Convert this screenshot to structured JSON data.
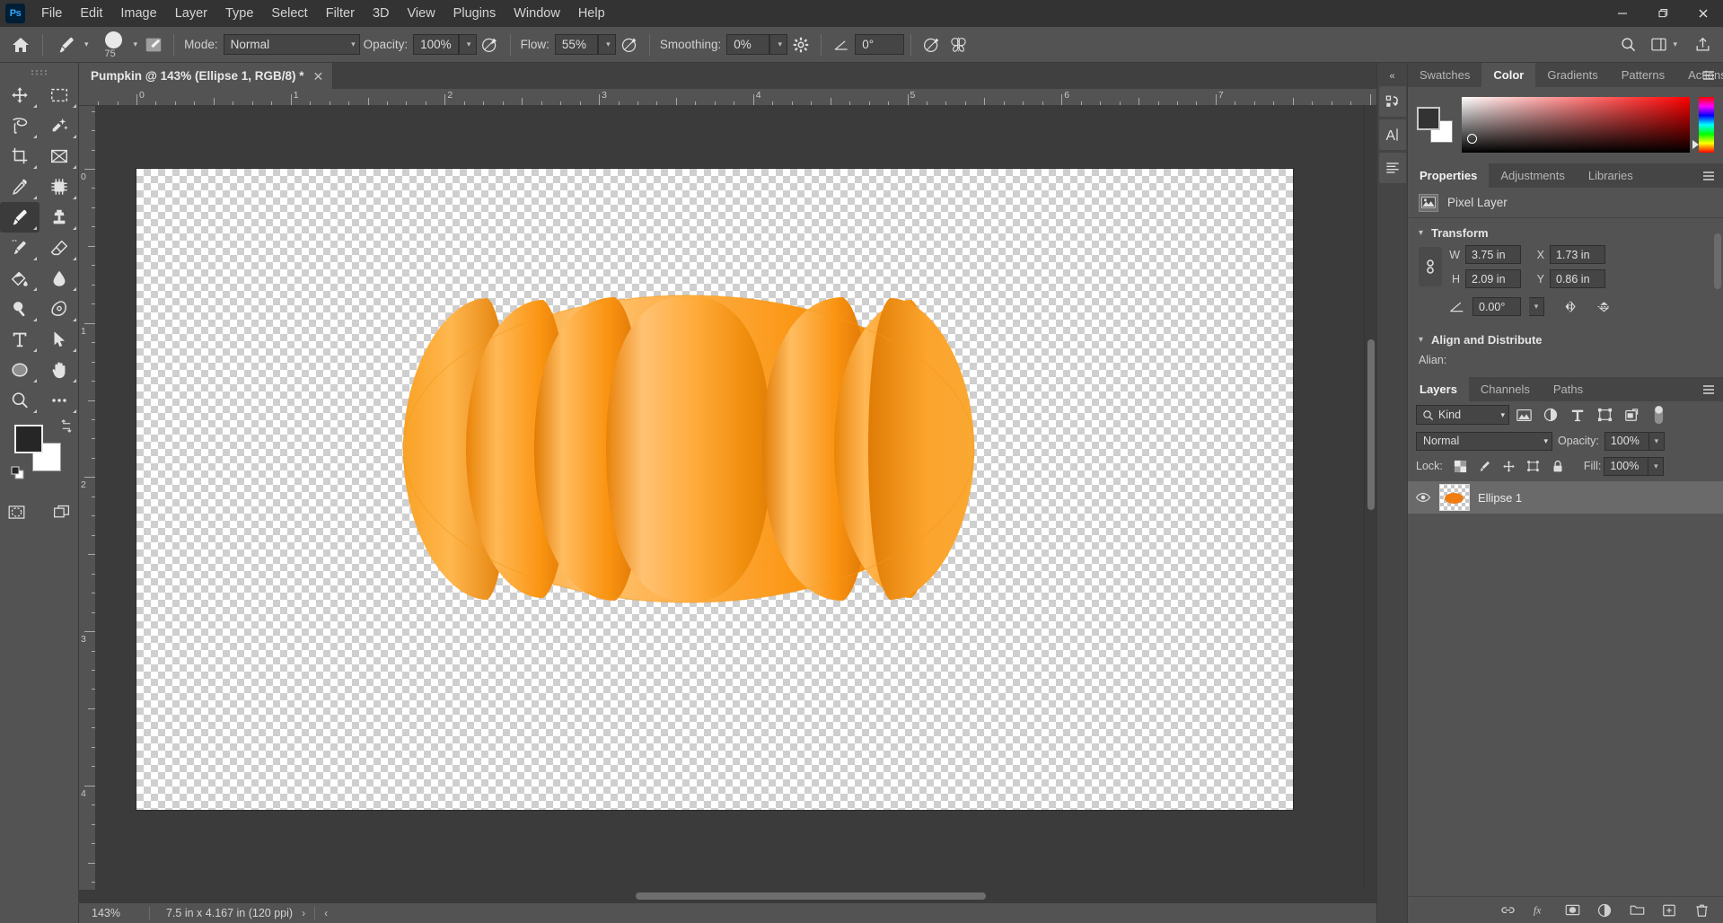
{
  "app": {
    "name": "Adobe Photoshop",
    "logo_text": "Ps",
    "accent": "#31a8ff"
  },
  "menubar": {
    "items": [
      {
        "label": "File"
      },
      {
        "label": "Edit"
      },
      {
        "label": "Image"
      },
      {
        "label": "Layer"
      },
      {
        "label": "Type"
      },
      {
        "label": "Select"
      },
      {
        "label": "Filter"
      },
      {
        "label": "3D"
      },
      {
        "label": "View"
      },
      {
        "label": "Plugins"
      },
      {
        "label": "Window"
      },
      {
        "label": "Help"
      }
    ],
    "window_controls": {
      "minimize": "—",
      "maximize": "❐",
      "close": "✕"
    }
  },
  "options_bar": {
    "home_icon": "home-icon",
    "brush_size": "75",
    "mode_label": "Mode:",
    "mode_value": "Normal",
    "opacity_label": "Opacity:",
    "opacity_value": "100%",
    "flow_label": "Flow:",
    "flow_value": "55%",
    "smoothing_label": "Smoothing:",
    "smoothing_value": "0%",
    "angle_value": "0°",
    "icons": {
      "airbrush": "airbrush-icon",
      "pressure_opacity": "pressure-opacity-icon",
      "pressure_size": "pressure-size-icon",
      "smoothing_options": "smoothing-options-gear-icon",
      "angle": "brush-angle-icon",
      "symmetry": "symmetry-butterfly-icon",
      "search": "search-icon",
      "workspace": "workspace-icon",
      "share": "share-icon"
    }
  },
  "toolbar": {
    "tools": [
      {
        "name": "move-tool",
        "selected": false
      },
      {
        "name": "rectangular-marquee-tool",
        "selected": false
      },
      {
        "name": "lasso-tool",
        "selected": false
      },
      {
        "name": "object-selection-tool",
        "selected": false
      },
      {
        "name": "crop-tool",
        "selected": false
      },
      {
        "name": "frame-tool",
        "selected": false
      },
      {
        "name": "eyedropper-tool",
        "selected": false
      },
      {
        "name": "spot-healing-brush-tool",
        "selected": false
      },
      {
        "name": "brush-tool",
        "selected": true
      },
      {
        "name": "clone-stamp-tool",
        "selected": false
      },
      {
        "name": "history-brush-tool",
        "selected": false
      },
      {
        "name": "eraser-tool",
        "selected": false
      },
      {
        "name": "gradient-tool",
        "selected": false
      },
      {
        "name": "blur-tool",
        "selected": false
      },
      {
        "name": "dodge-tool",
        "selected": false
      },
      {
        "name": "pen-tool",
        "selected": false
      },
      {
        "name": "horizontal-type-tool",
        "selected": false
      },
      {
        "name": "path-selection-tool",
        "selected": false
      },
      {
        "name": "ellipse-tool",
        "selected": false
      },
      {
        "name": "hand-tool",
        "selected": false
      },
      {
        "name": "zoom-tool",
        "selected": false
      },
      {
        "name": "edit-toolbar-tool",
        "selected": false
      }
    ],
    "foreground_color": "#262626",
    "background_color": "#ffffff",
    "swap_icon": "swap-colors-icon",
    "default_colors_icon": "default-colors-icon",
    "quick_mask_icon": "quick-mask-icon",
    "screen_mode_icon": "screen-mode-icon"
  },
  "document": {
    "tab_title": "Pumpkin @ 143% (Ellipse 1, RGB/8) *",
    "close_glyph": "✕"
  },
  "rulers": {
    "unit": "in",
    "horizontal_labels": [
      "0",
      "1",
      "2",
      "3",
      "4",
      "5",
      "6",
      "7"
    ],
    "vertical_labels": [
      "0",
      "1",
      "2",
      "3",
      "4"
    ]
  },
  "status_bar": {
    "zoom": "143%",
    "dimensions": "7.5 in x 4.167 in (120 ppi)",
    "arrow_right": "›",
    "arrow_left": "‹"
  },
  "icon_rail": {
    "collapse": "«",
    "buttons": [
      {
        "name": "history-panel-icon"
      },
      {
        "name": "character-panel-icon"
      },
      {
        "name": "paragraph-panel-icon"
      }
    ]
  },
  "color_panel": {
    "tabs": [
      {
        "label": "Swatches",
        "active": false
      },
      {
        "label": "Color",
        "active": true
      },
      {
        "label": "Gradients",
        "active": false
      },
      {
        "label": "Patterns",
        "active": false
      },
      {
        "label": "Actions",
        "active": false
      }
    ],
    "menu_icon": "panel-menu-icon",
    "foreground_color": "#333333",
    "background_color": "#ffffff",
    "picker_base_hue": "#ff0000"
  },
  "properties_panel": {
    "tabs": [
      {
        "label": "Properties",
        "active": true
      },
      {
        "label": "Adjustments",
        "active": false
      },
      {
        "label": "Libraries",
        "active": false
      }
    ],
    "menu_icon": "panel-menu-icon",
    "layer_kind": "Pixel Layer",
    "layer_kind_icon": "pixel-layer-icon",
    "transform": {
      "section_title": "Transform",
      "link_icon": "link-aspect-ratio-icon",
      "w_label": "W",
      "w_value": "3.75 in",
      "h_label": "H",
      "h_value": "2.09 in",
      "x_label": "X",
      "x_value": "1.73 in",
      "y_label": "Y",
      "y_value": "0.86 in",
      "angle_icon": "rotation-angle-icon",
      "angle_value": "0.00°",
      "flip_horizontal_icon": "flip-horizontal-icon",
      "flip_vertical_icon": "flip-vertical-icon"
    },
    "align": {
      "section_title": "Align and Distribute",
      "align_label": "Alian:"
    }
  },
  "layers_panel": {
    "tabs": [
      {
        "label": "Layers",
        "active": true
      },
      {
        "label": "Channels",
        "active": false
      },
      {
        "label": "Paths",
        "active": false
      }
    ],
    "menu_icon": "panel-menu-icon",
    "filter": {
      "search_icon": "search-icon",
      "kind_label": "Kind",
      "filter_icons": [
        {
          "name": "filter-pixel-icon"
        },
        {
          "name": "filter-adjustment-icon"
        },
        {
          "name": "filter-type-icon"
        },
        {
          "name": "filter-shape-icon"
        },
        {
          "name": "filter-smart-object-icon"
        }
      ],
      "toggle_icon": "filter-toggle-switch"
    },
    "blend_mode": "Normal",
    "opacity_label": "Opacity:",
    "opacity_value": "100%",
    "lock_label": "Lock:",
    "lock_icons": [
      {
        "name": "lock-transparent-pixels-icon"
      },
      {
        "name": "lock-image-pixels-icon"
      },
      {
        "name": "lock-position-icon"
      },
      {
        "name": "lock-artboard-nesting-icon"
      },
      {
        "name": "lock-all-icon"
      }
    ],
    "fill_label": "Fill:",
    "fill_value": "100%",
    "layers": [
      {
        "name": "Ellipse 1",
        "visible": true,
        "selected": true,
        "thumbnail": "pumpkin-thumbnail"
      }
    ],
    "footer_icons": [
      {
        "name": "link-layers-icon"
      },
      {
        "name": "layer-style-fx-icon"
      },
      {
        "name": "add-layer-mask-icon"
      },
      {
        "name": "new-fill-adjustment-layer-icon"
      },
      {
        "name": "new-group-icon"
      },
      {
        "name": "new-layer-icon"
      },
      {
        "name": "delete-layer-icon"
      }
    ]
  },
  "canvas": {
    "artwork_name": "pumpkin-illustration",
    "artwork_colors": {
      "light": "#ffb347",
      "mid": "#fb9412",
      "dark": "#e8790a",
      "deep": "#d86a05"
    },
    "transparency_checker": true
  }
}
